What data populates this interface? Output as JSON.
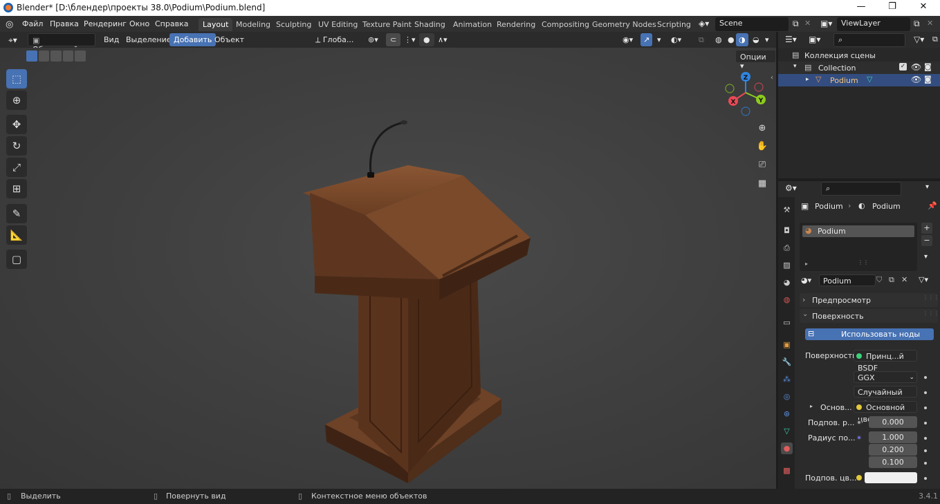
{
  "title": "Blender* [D:\\блендер\\проекты 38.0\\Podium\\Podium.blend]",
  "window_controls": {
    "minimize": "—",
    "maximize": "❐",
    "close": "✕"
  },
  "menu": [
    "Файл",
    "Правка",
    "Рендеринг",
    "Окно",
    "Справка"
  ],
  "workspaces": [
    "Layout",
    "Modeling",
    "Sculpting",
    "UV Editing",
    "Texture Paint",
    "Shading",
    "Animation",
    "Rendering",
    "Compositing",
    "Geometry Nodes",
    "Scripting"
  ],
  "active_workspace": "Layout",
  "scene": "Scene",
  "view_layer": "ViewLayer",
  "viewport_header": {
    "mode": "Объектный...",
    "view": "Вид",
    "select": "Выделение",
    "add": "Добавить",
    "object": "Объект",
    "orientation": "Глоба...",
    "options": "Опции"
  },
  "gizmo": {
    "x": "X",
    "y": "Y",
    "z": "Z"
  },
  "outliner": {
    "scene_collection": "Коллекция сцены",
    "collection": "Collection",
    "object": "Podium"
  },
  "properties": {
    "breadcrumb_object": "Podium",
    "breadcrumb_material": "Podium",
    "slot": "Podium",
    "material_name": "Podium",
    "preview_panel": "Предпросмотр",
    "surface_panel": "Поверхность",
    "use_nodes": "Использовать ноды",
    "surface_label": "Поверхность",
    "surface_shader": "Принц...й BSDF",
    "distribution": "GGX",
    "subsurface_method": "Случайный об...",
    "base_label": "Основ...",
    "base_value": "Основной цвет",
    "subsurface_label": "Подпов. р...",
    "subsurface_value": "0.000",
    "radius_label": "Радиус по...",
    "radius_values": [
      "1.000",
      "0.200",
      "0.100"
    ],
    "subsurface_color_label": "Подпов. цв..."
  },
  "status": {
    "select": "Выделить",
    "rotate": "Повернуть вид",
    "context": "Контекстное меню объектов",
    "version": "3.4.1"
  },
  "colors": {
    "accent": "#4772b3",
    "x_axis": "#e94a55",
    "y_axis": "#8ccb1d",
    "z_axis": "#2f85e3",
    "wood": "#7a4a2a"
  }
}
